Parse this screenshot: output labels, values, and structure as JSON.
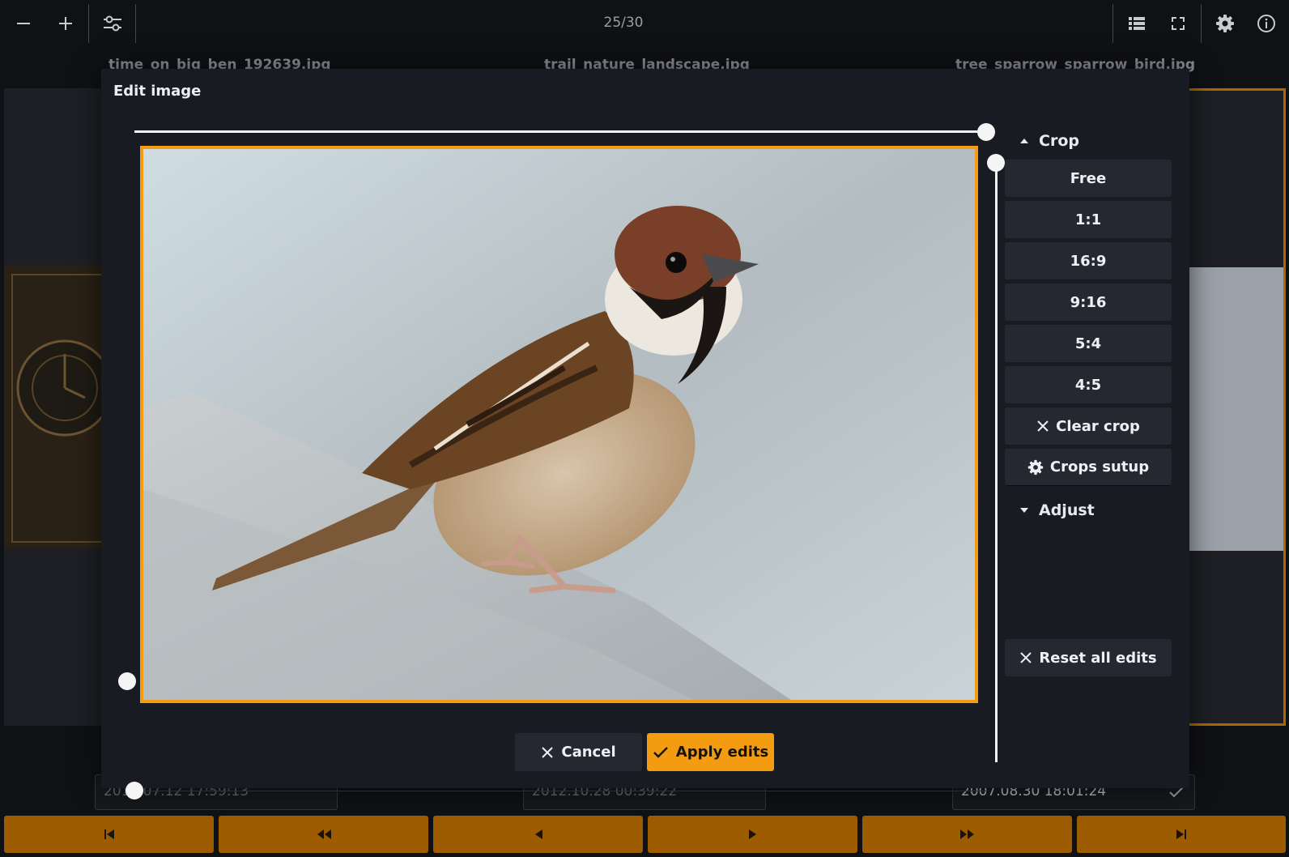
{
  "toolbar": {
    "counter": "25/30",
    "left_icons": [
      "zoom-out-icon",
      "zoom-in-icon",
      "sliders-icon"
    ],
    "right_icons": [
      "list-icon",
      "fullscreen-icon",
      "gear-icon",
      "info-icon"
    ]
  },
  "gallery": {
    "files": [
      {
        "name": "time_on_big_ben_192639.jpg",
        "timestamp": "2010.07.12 17:59:13"
      },
      {
        "name": "trail_nature_landscape.jpg",
        "timestamp": "2012.10.28 00:39:22"
      },
      {
        "name": "tree_sparrow_sparrow_bird.jpg",
        "timestamp": "2007.08.30 18:01:24"
      }
    ],
    "selected_check_icon": "check-icon"
  },
  "dialog": {
    "title": "Edit image",
    "crop_section": "Crop",
    "crop_ratios": [
      "Free",
      "1:1",
      "16:9",
      "9:16",
      "5:4",
      "4:5"
    ],
    "clear_crop": "Clear crop",
    "crops_setup": "Crops sutup",
    "adjust_section": "Adjust",
    "reset_all": "Reset all edits",
    "cancel": "Cancel",
    "apply": "Apply edits"
  },
  "nav_icons": [
    "skip-first-icon",
    "fast-rewind-icon",
    "previous-icon",
    "next-icon",
    "fast-forward-icon",
    "skip-last-icon"
  ],
  "colors": {
    "accent": "#f39c12",
    "nav_button": "#9d5c00",
    "dialog_bg": "#181b22",
    "button_bg": "#252830"
  }
}
